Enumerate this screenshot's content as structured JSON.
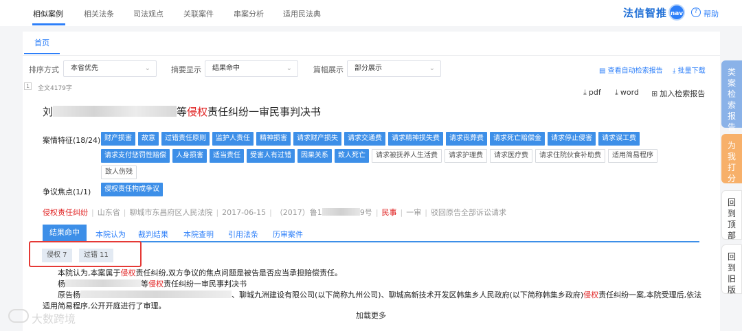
{
  "nav": {
    "tabs": [
      "相似案例",
      "相关法条",
      "司法观点",
      "关联案件",
      "串案分析",
      "适用民法典"
    ],
    "brand": "法信智推",
    "brand_badge": "nav",
    "help": "帮助"
  },
  "home_tab": "首页",
  "filters": {
    "sort_label": "排序方式",
    "sort_value": "本省优先",
    "summary_label": "摘要显示",
    "summary_value": "结果命中",
    "length_label": "篇幅展示",
    "length_value": "部分展示",
    "view_report": "查看自动检索报告",
    "batch_download": "批量下载"
  },
  "result": {
    "index": "1",
    "fulltext": "全文4179字",
    "actions": {
      "pdf": "pdf",
      "word": "word",
      "add_report": "加入检索报告"
    },
    "title_prefix": "刘",
    "title_suffix_1": "等",
    "title_highlight": "侵权",
    "title_suffix_2": "责任纠纷一审民事判决书",
    "features_label": "案情特征(18/24)",
    "features_row1": [
      "财产损害",
      "故意",
      "过错责任原则",
      "监护人责任",
      "精神损害",
      "请求财产损失",
      "请求交通费",
      "请求精神损失费",
      "请求丧葬费",
      "请求死亡赔偿金",
      "请求停止侵害",
      "请求误工费"
    ],
    "features_row2_blue": [
      "请求支付惩罚性赔偿",
      "人身损害",
      "适当责任",
      "受害人有过错",
      "因果关系",
      "致人死亡"
    ],
    "features_row2_plain": [
      "请求被抚养人生活费",
      "请求护理费",
      "请求医疗费",
      "请求住院伙食补助费",
      "适用简易程序"
    ],
    "features_row3_plain": [
      "致人伤残"
    ],
    "dispute_label": "争议焦点(1/1)",
    "dispute_tag": "侵权责任构成争议",
    "meta": {
      "cause": "侵权责任纠纷",
      "province": "山东省",
      "court": "聊城市东昌府区人民法院",
      "date": "2017-06-15",
      "case_no_prefix": "（2017）鲁1",
      "case_no_suffix": "9号",
      "case_type": "民事",
      "level": "一审",
      "outcome": "驳回原告全部诉讼请求"
    },
    "subtabs": [
      "结果命中",
      "本院认为",
      "裁判结果",
      "本院查明",
      "引用法条",
      "历审案件"
    ],
    "hit_tags": [
      "侵权 7",
      "过错 11"
    ],
    "body": {
      "line1_a": "本院认为,本案属于",
      "line1_hl": "侵权",
      "line1_b": "责任纠纷,双方争议的焦点问题是被告是否应当承担赔偿责任。",
      "line2_a": "杨",
      "line2_b": "等",
      "line2_hl": "侵权",
      "line2_c": "责任纠纷一审民事判决书",
      "line3_a": "原告杨",
      "line3_b": "、聊城九洲建设有限公司(以下简称九州公司)、聊城高新技术开发区韩集乡人民政府(以下简称韩集乡政府)",
      "line3_hl": "侵权",
      "line3_c": "责任纠纷一案,本院受理后,依法",
      "line4": "适用简易程序,公开开庭进行了审理。"
    },
    "load_more": "加载更多"
  },
  "side": {
    "report": "类案检索报告",
    "fight": "为我打分",
    "top": "回到顶部",
    "old": "回到旧版"
  },
  "watermark": "大数跨境",
  "colors": {
    "accent": "#2d7ff9",
    "chip_blue": "#3d8fe8",
    "highlight_red": "#e02020",
    "box_red": "#e53935"
  }
}
